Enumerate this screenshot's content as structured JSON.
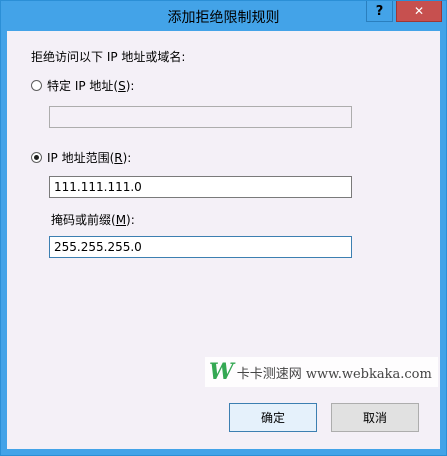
{
  "window": {
    "title": "添加拒绝限制规则",
    "help_glyph": "?",
    "close_glyph": "✕"
  },
  "form": {
    "heading": "拒绝访问以下 IP 地址或域名:",
    "specific_ip": {
      "label_prefix": "特定 IP 地址(",
      "accelerator": "S",
      "label_suffix": "):",
      "value": "",
      "selected": false
    },
    "ip_range": {
      "label_prefix": "IP 地址范围(",
      "accelerator": "R",
      "label_suffix": "):",
      "value": "111.111.111.0",
      "selected": true
    },
    "mask": {
      "label_prefix": "掩码或前缀(",
      "accelerator": "M",
      "label_suffix": "):",
      "value": "255.255.255.0"
    }
  },
  "buttons": {
    "ok": "确定",
    "cancel": "取消"
  },
  "watermark": {
    "logo": "W",
    "text": "卡卡测速网 www.webkaka.com"
  },
  "colors": {
    "titlebar": "#43a3e8",
    "close_button": "#c7504f",
    "client_background": "#f4f0f7",
    "watermark_green": "#34a853"
  }
}
